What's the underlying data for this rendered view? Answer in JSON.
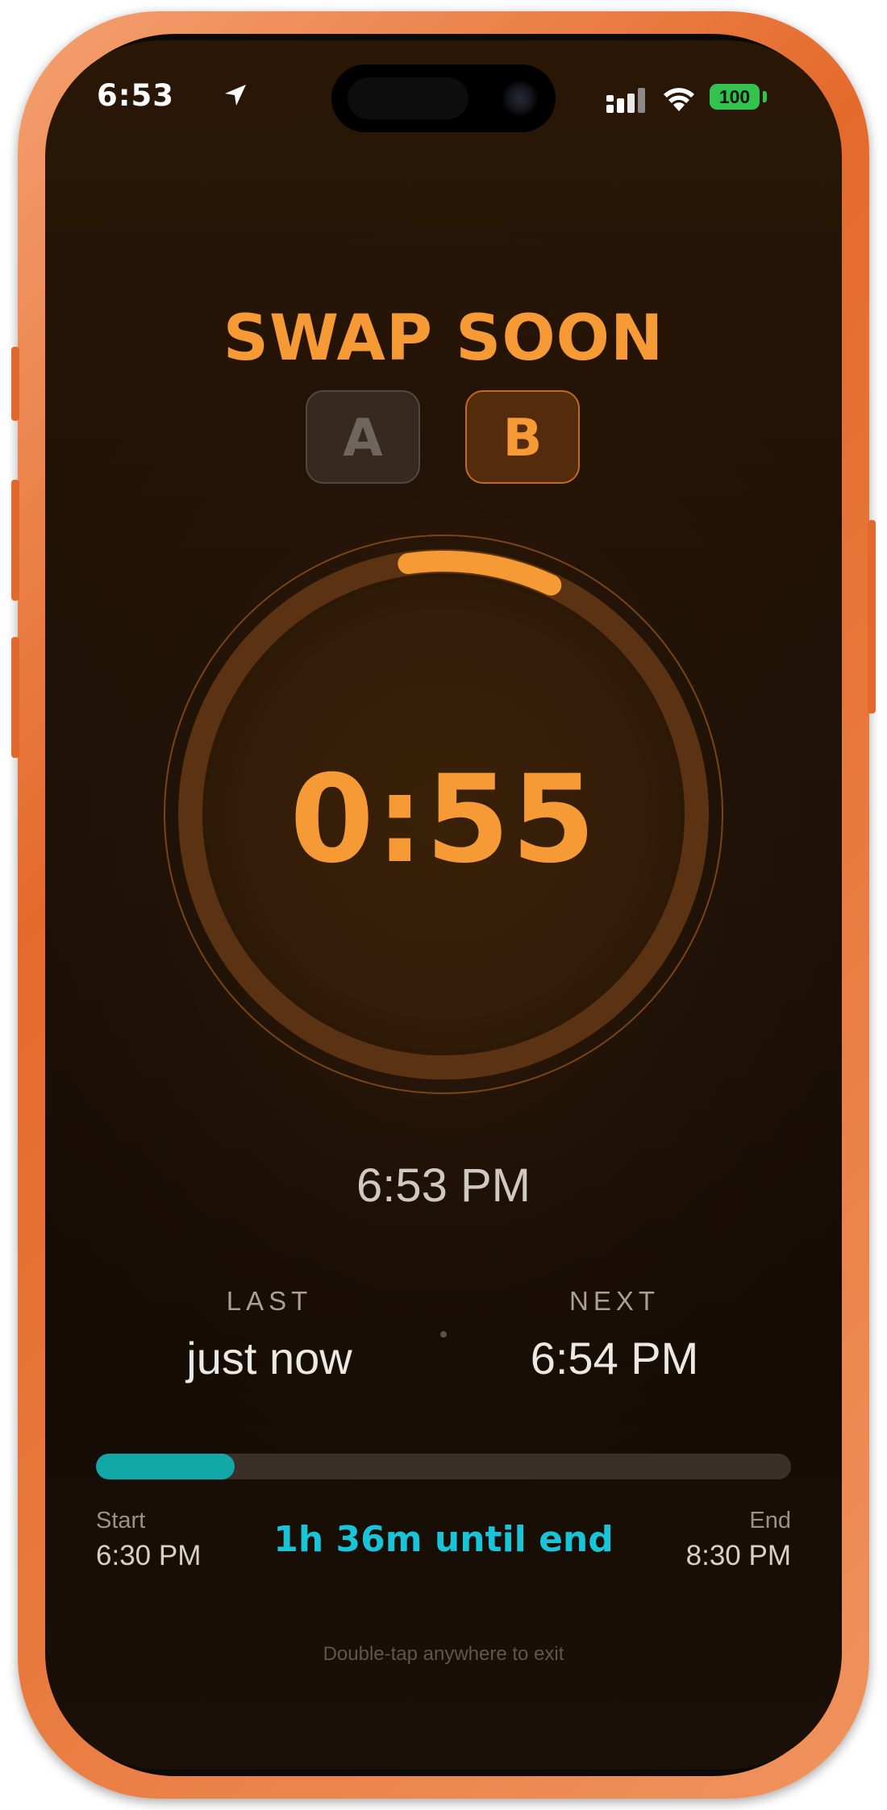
{
  "status_bar": {
    "time": "6:53",
    "location_icon": "location-arrow-icon",
    "signal_icon": "cellular-signal-icon",
    "wifi_icon": "wifi-icon",
    "battery_level": "100"
  },
  "header": {
    "title": "SWAP SOON"
  },
  "sides": [
    {
      "label": "A",
      "active": false
    },
    {
      "label": "B",
      "active": true
    }
  ],
  "timer": {
    "countdown": "0:55",
    "ring_progress": 0.08
  },
  "clock": {
    "current_time": "6:53 PM"
  },
  "schedule": {
    "last_label": "LAST",
    "last_value": "just now",
    "next_label": "NEXT",
    "next_value": "6:54 PM"
  },
  "session": {
    "progress": 0.2,
    "start_label": "Start",
    "start_time": "6:30 PM",
    "end_label": "End",
    "end_time": "8:30 PM",
    "remaining_text": "1h 36m until end"
  },
  "footer": {
    "hint": "Double-tap anywhere to exit"
  },
  "colors": {
    "accent": "#f59a35",
    "progress": "#13a8a8",
    "remaining": "#19c3d8",
    "frame": "#e46a2c"
  }
}
